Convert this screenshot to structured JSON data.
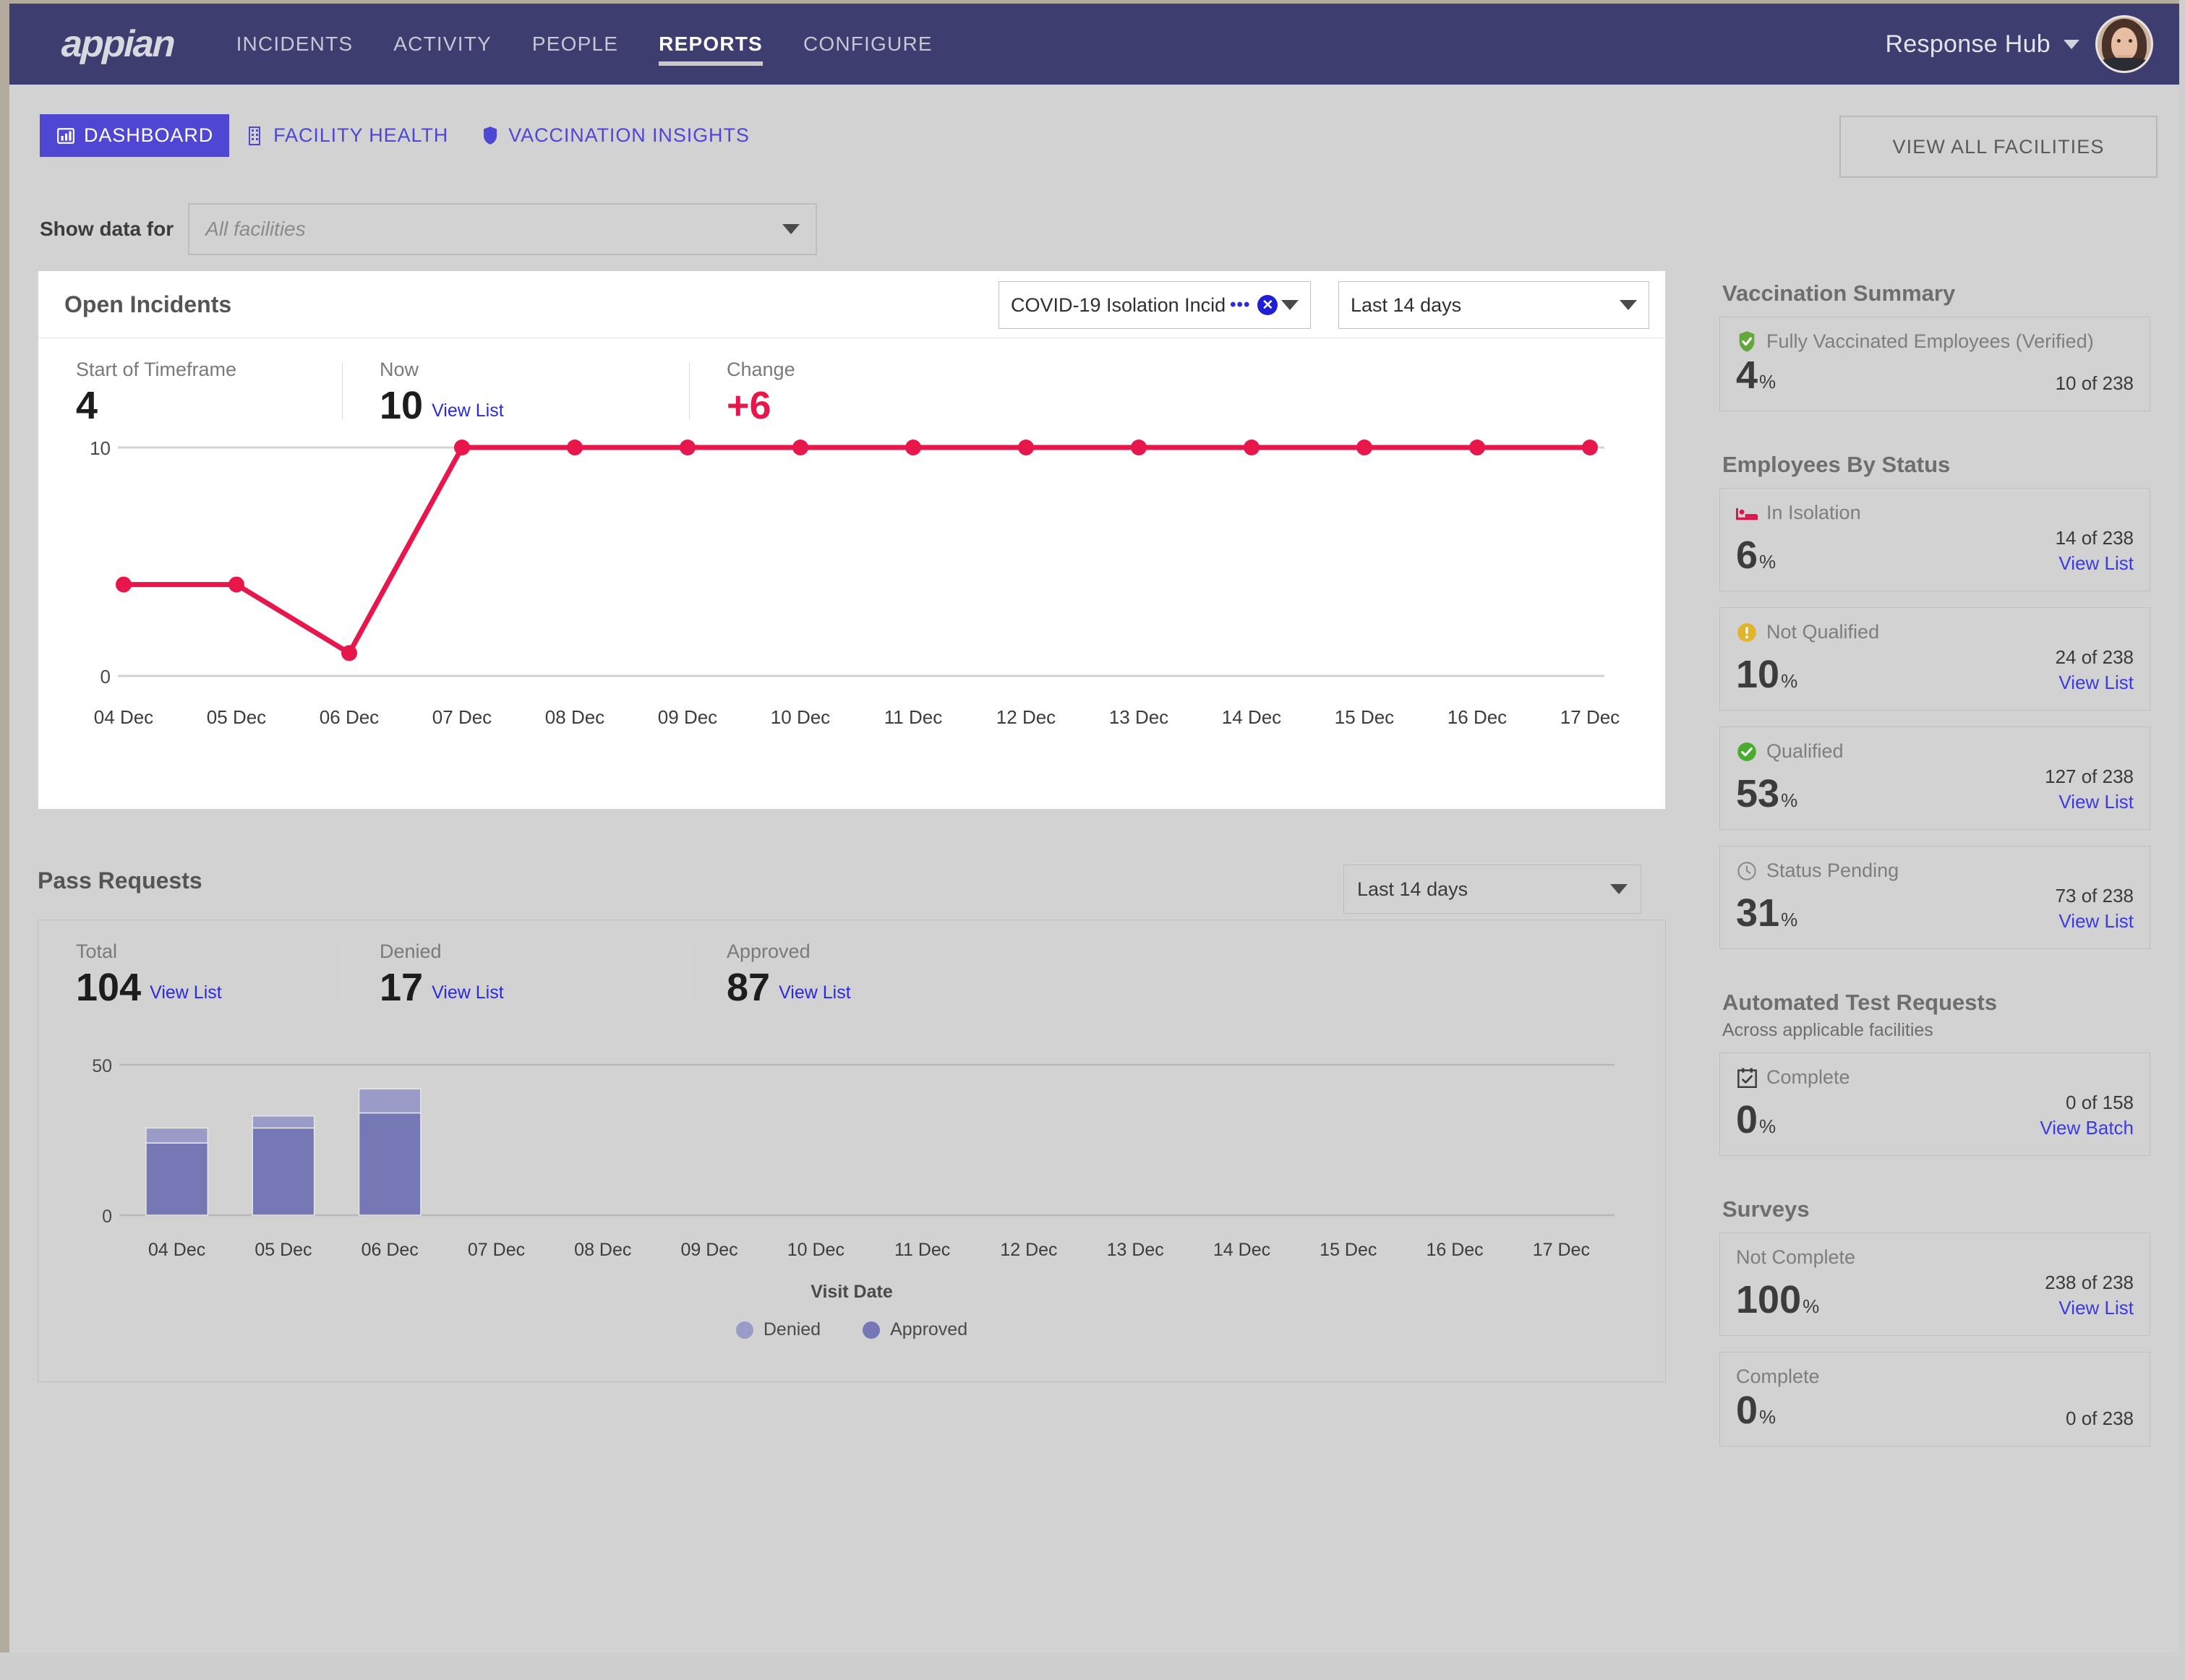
{
  "topnav": {
    "logo": "appian",
    "links": [
      {
        "label": "INCIDENTS",
        "active": false
      },
      {
        "label": "ACTIVITY",
        "active": false
      },
      {
        "label": "PEOPLE",
        "active": false
      },
      {
        "label": "REPORTS",
        "active": true
      },
      {
        "label": "CONFIGURE",
        "active": false
      }
    ],
    "hub_name": "Response Hub",
    "hub_caret_icon": "chevron-down-icon",
    "avatar_icon": "user-avatar"
  },
  "tabs": [
    {
      "label": "DASHBOARD",
      "icon": "bar-chart-icon",
      "active": true
    },
    {
      "label": "FACILITY HEALTH",
      "icon": "building-icon",
      "active": false
    },
    {
      "label": "VACCINATION INSIGHTS",
      "icon": "shield-icon",
      "active": false
    }
  ],
  "view_all_facilities_label": "VIEW ALL FACILITIES",
  "filter": {
    "label": "Show data for",
    "placeholder": "All facilities",
    "value": ""
  },
  "open_incidents": {
    "title": "Open Incidents",
    "type_filter_value": "COVID-19 Isolation Incid",
    "type_filter_overflow": "•••",
    "clear_icon": "clear-circle-icon",
    "range_value": "Last 14 days",
    "kpis": [
      {
        "label": "Start of Timeframe",
        "value": "4",
        "link": ""
      },
      {
        "label": "Now",
        "value": "10",
        "link": "View List"
      },
      {
        "label": "Change",
        "value": "+6",
        "link": ""
      }
    ]
  },
  "pass_requests": {
    "title": "Pass Requests",
    "range_value": "Last 14 days",
    "kpis": [
      {
        "label": "Total",
        "value": "104",
        "link": "View List"
      },
      {
        "label": "Denied",
        "value": "17",
        "link": "View List"
      },
      {
        "label": "Approved",
        "value": "87",
        "link": "View List"
      }
    ],
    "xlabel": "Visit Date",
    "legend": [
      {
        "label": "Denied",
        "color": "#9b9bc8"
      },
      {
        "label": "Approved",
        "color": "#7678b5"
      }
    ]
  },
  "rail": {
    "vaccination_summary": {
      "heading": "Vaccination Summary",
      "tiles": [
        {
          "label": "Fully Vaccinated Employees (Verified)",
          "icon": "shield-check-icon",
          "icon_color": "#64a83c",
          "percent": "4",
          "percent_suffix": "%",
          "count": "10 of 238",
          "link": ""
        }
      ]
    },
    "employees_by_status": {
      "heading": "Employees By Status",
      "tiles": [
        {
          "label": "In Isolation",
          "icon": "bed-icon",
          "icon_color": "#d6174b",
          "percent": "6",
          "percent_suffix": "%",
          "count": "14 of 238",
          "link": "View List"
        },
        {
          "label": "Not Qualified",
          "icon": "warning-icon",
          "icon_color": "#e0b42c",
          "percent": "10",
          "percent_suffix": "%",
          "count": "24 of 238",
          "link": "View List"
        },
        {
          "label": "Qualified",
          "icon": "check-circle-icon",
          "icon_color": "#4aac2f",
          "percent": "53",
          "percent_suffix": "%",
          "count": "127 of 238",
          "link": "View List"
        },
        {
          "label": "Status Pending",
          "icon": "clock-icon",
          "icon_color": "#8a8a8a",
          "percent": "31",
          "percent_suffix": "%",
          "count": "73 of 238",
          "link": "View List"
        }
      ]
    },
    "automated_test_requests": {
      "heading": "Automated Test Requests",
      "subheading": "Across applicable facilities",
      "tiles": [
        {
          "label": "Complete",
          "icon": "calendar-check-icon",
          "icon_color": "#3c3c3c",
          "percent": "0",
          "percent_suffix": "%",
          "count": "0 of 158",
          "link": "View Batch"
        }
      ]
    },
    "surveys": {
      "heading": "Surveys",
      "tiles": [
        {
          "label": "Not Complete",
          "icon": "",
          "icon_color": "",
          "percent": "100",
          "percent_suffix": "%",
          "count": "238 of 238",
          "link": "View List"
        },
        {
          "label": "Complete",
          "icon": "",
          "icon_color": "",
          "percent": "0",
          "percent_suffix": "%",
          "count": "0 of 238",
          "link": ""
        }
      ]
    }
  },
  "chart_data": [
    {
      "type": "line",
      "title": "Open Incidents",
      "xlabel": "",
      "ylabel": "",
      "categories": [
        "04 Dec",
        "05 Dec",
        "06 Dec",
        "07 Dec",
        "08 Dec",
        "09 Dec",
        "10 Dec",
        "11 Dec",
        "12 Dec",
        "13 Dec",
        "14 Dec",
        "15 Dec",
        "16 Dec",
        "17 Dec"
      ],
      "series": [
        {
          "name": "Open Incidents",
          "color": "#e8174b",
          "values": [
            4,
            4,
            1,
            10,
            10,
            10,
            10,
            10,
            10,
            10,
            10,
            10,
            10,
            10
          ]
        }
      ],
      "ylim": [
        0,
        10
      ],
      "yticks": [
        0,
        10
      ],
      "grid": true,
      "legend": "none",
      "markers": true
    },
    {
      "type": "bar",
      "title": "Pass Requests",
      "stacked": true,
      "xlabel": "Visit Date",
      "ylabel": "",
      "categories": [
        "04 Dec",
        "05 Dec",
        "06 Dec",
        "07 Dec",
        "08 Dec",
        "09 Dec",
        "10 Dec",
        "11 Dec",
        "12 Dec",
        "13 Dec",
        "14 Dec",
        "15 Dec",
        "16 Dec",
        "17 Dec"
      ],
      "series": [
        {
          "name": "Approved",
          "color": "#7678b5",
          "values": [
            24,
            29,
            34,
            0,
            0,
            0,
            0,
            0,
            0,
            0,
            0,
            0,
            0,
            0
          ]
        },
        {
          "name": "Denied",
          "color": "#9b9bc8",
          "values": [
            5,
            4,
            8,
            0,
            0,
            0,
            0,
            0,
            0,
            0,
            0,
            0,
            0,
            0
          ]
        }
      ],
      "ylim": [
        0,
        50
      ],
      "yticks": [
        0,
        50
      ],
      "grid": true,
      "legend": "bottom-center"
    }
  ]
}
